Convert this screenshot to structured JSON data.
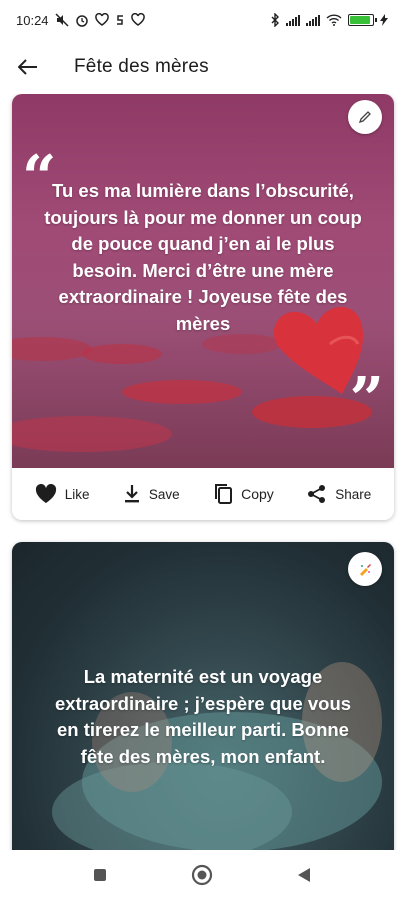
{
  "status_bar": {
    "time": "10:24"
  },
  "app_bar": {
    "title": "Fête des mères"
  },
  "cards": [
    {
      "quote": "Tu es ma lumière dans l’obscurité, toujours là pour me donner un coup de pouce quand j’en ai le plus besoin. Merci d’être une mère extraordinaire ! Joyeuse fête des mères",
      "actions": {
        "like": "Like",
        "save": "Save",
        "copy": "Copy",
        "share": "Share"
      }
    },
    {
      "quote": "La maternité est un voyage extraordinaire ; j’espère que vous en tirerez le meilleur parti. Bonne fête des mères, mon enfant."
    }
  ],
  "colors": {
    "card1_background": "#9c4a74",
    "heart": "#d8323c",
    "card2_background": "#2c3d43",
    "battery": "#39c13a"
  },
  "icons": {
    "back": "arrow-left-icon",
    "edit": "pencil-icon",
    "like": "heart-icon",
    "save": "download-icon",
    "copy": "copy-icon",
    "share": "share-icon",
    "nav_recent": "square-icon",
    "nav_home": "circle-icon",
    "nav_back": "triangle-back-icon"
  }
}
